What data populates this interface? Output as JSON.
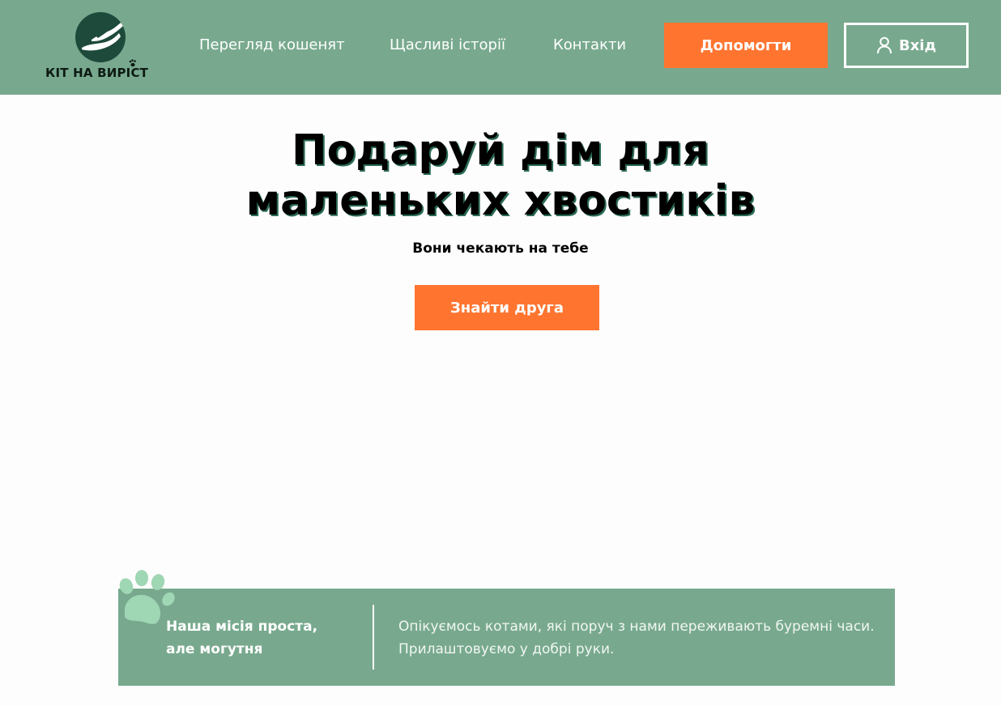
{
  "header": {
    "logo_text": "КІТ НА ВИРІСТ",
    "nav": [
      {
        "label": "Перегляд кошенят"
      },
      {
        "label": "Щасливі історії"
      },
      {
        "label": "Контакти"
      }
    ],
    "help_button": "Допомогти",
    "login_button": "Вхід",
    "icons": {
      "login": "user-icon",
      "logo": "cat-hands-logo-icon",
      "paw": "paw-icon"
    }
  },
  "hero": {
    "title_line1": "Подаруй дім для",
    "title_line2": "маленьких хвостиків",
    "subtitle": "Вони чекають на тебе",
    "cta": "Знайти друга"
  },
  "mission": {
    "title_line1": "Наша місія проста,",
    "title_line2": "але могутня",
    "text_line1": "Опікуємось котами, які поруч з нами переживають буремні часи.",
    "text_line2": "Прилаштовуємо у добрі руки."
  },
  "colors": {
    "header_bg": "#78a98e",
    "accent": "#ff7530",
    "logo_dark": "#1d4a3b",
    "paw_light": "#9fd6b4"
  }
}
